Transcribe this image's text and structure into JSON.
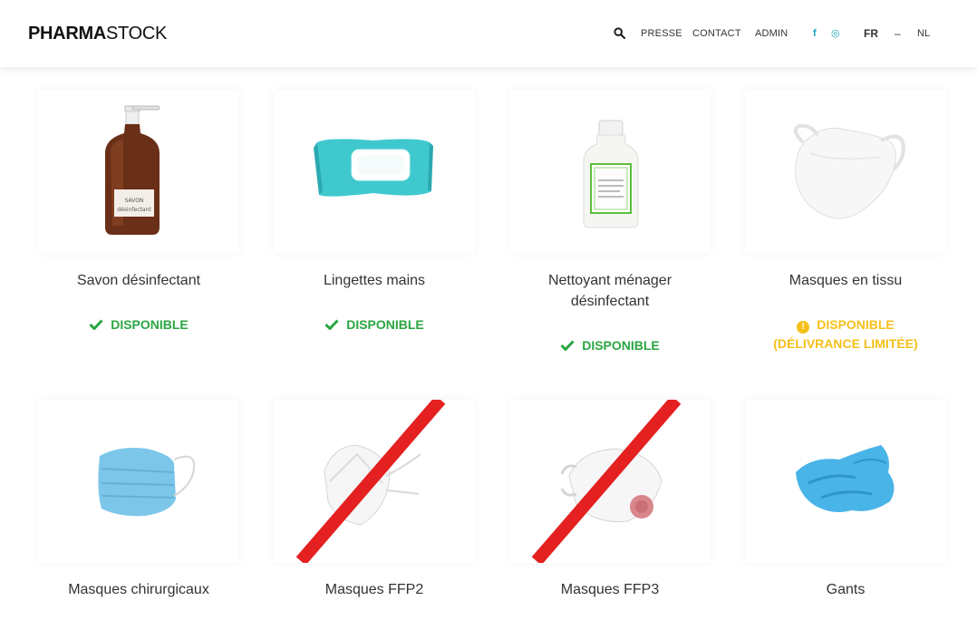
{
  "header": {
    "logo_bold": "PHARMA",
    "logo_regular": "STOCK",
    "nav": [
      "PRESSE",
      "CONTACT",
      "ADMIN"
    ],
    "social": {
      "facebook": "f",
      "instagram": "◎"
    },
    "lang_current": "FR",
    "lang_separator": "–",
    "lang_other": "NL"
  },
  "colors": {
    "available": "#2aa642",
    "limited": "#f5c01a",
    "social": "#1aa3b8",
    "unavailable_strike": "#e42020"
  },
  "products": [
    {
      "name": "Savon désinfectant",
      "status": "DISPONIBLE",
      "status_type": "available",
      "icon": "soap-bottle"
    },
    {
      "name": "Lingettes mains",
      "status": "DISPONIBLE",
      "status_type": "available",
      "icon": "wipes-pack"
    },
    {
      "name_line1": "Nettoyant ménager",
      "name_line2": "désinfectant",
      "status": "DISPONIBLE",
      "status_type": "available",
      "icon": "cleaner-bottle"
    },
    {
      "name": "Masques en tissu",
      "status_line1": "DISPONIBLE",
      "status_line2": "(DÉLIVRANCE LIMITÉE)",
      "status_type": "limited",
      "icon": "cloth-mask"
    },
    {
      "name": "Masques chirurgicaux",
      "icon": "surgical-mask"
    },
    {
      "name": "Masques FFP2",
      "icon": "ffp2-mask",
      "crossed_out": true
    },
    {
      "name": "Masques FFP3",
      "icon": "ffp3-mask",
      "crossed_out": true
    },
    {
      "name": "Gants",
      "icon": "gloves"
    }
  ],
  "product_labels": {
    "soap_label_1": "SAVON",
    "soap_label_2": "désinfectant"
  }
}
